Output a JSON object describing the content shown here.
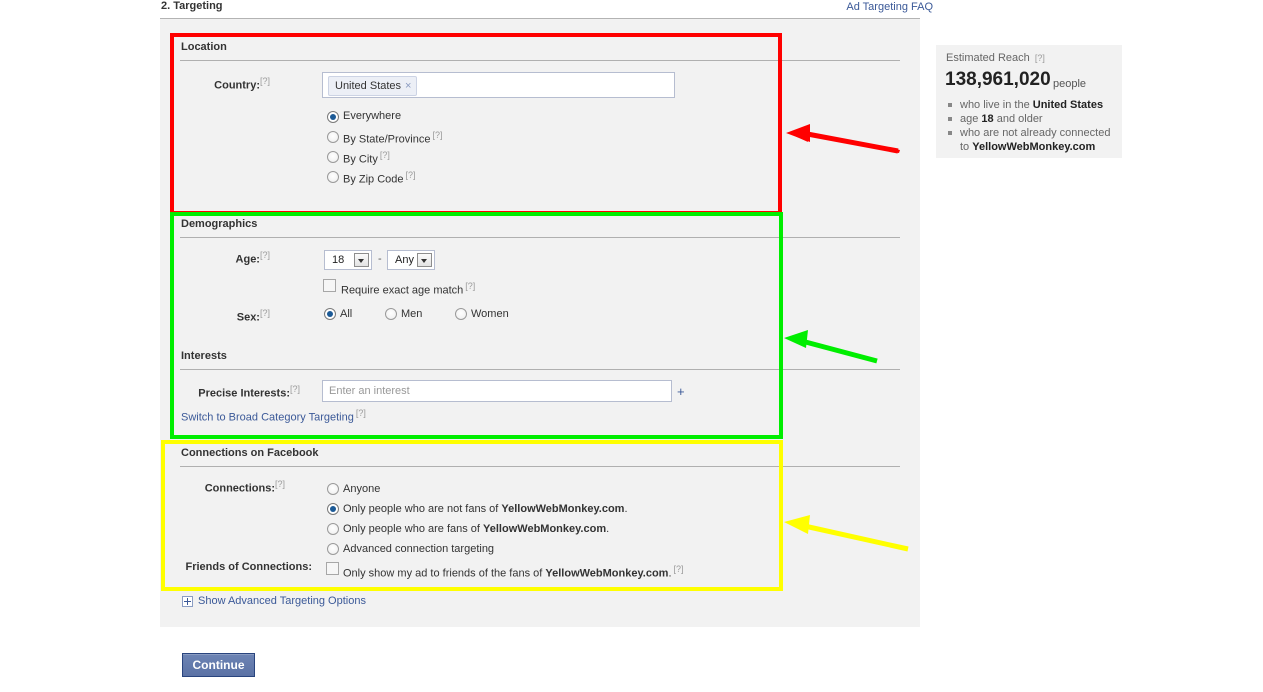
{
  "header": {
    "step_title": "2. Targeting",
    "faq_link": "Ad Targeting FAQ"
  },
  "location": {
    "heading": "Location",
    "country_label": "Country:",
    "help": "[?]",
    "token_value": "United States",
    "token_remove": "×",
    "options": [
      {
        "label": "Everywhere",
        "selected": true,
        "help": ""
      },
      {
        "label": "By State/Province",
        "selected": false,
        "help": "[?]"
      },
      {
        "label": "By City",
        "selected": false,
        "help": "[?]"
      },
      {
        "label": "By Zip Code",
        "selected": false,
        "help": "[?]"
      }
    ]
  },
  "demographics": {
    "heading": "Demographics",
    "age_label": "Age:",
    "age_min": "18",
    "age_max": "Any",
    "age_separator": "-",
    "exact_age_label": "Require exact age match",
    "exact_age_checked": false,
    "sex_label": "Sex:",
    "sex_options": [
      {
        "label": "All",
        "selected": true
      },
      {
        "label": "Men",
        "selected": false
      },
      {
        "label": "Women",
        "selected": false
      }
    ]
  },
  "interests": {
    "heading": "Interests",
    "precise_label": "Precise Interests:",
    "input_placeholder": "Enter an interest",
    "input_value": "",
    "add_icon": "+",
    "switch_link": "Switch to Broad Category Targeting"
  },
  "connections": {
    "heading": "Connections on Facebook",
    "connections_label": "Connections:",
    "options": [
      {
        "text": "Anyone",
        "bold": "",
        "tail": "",
        "selected": false
      },
      {
        "text": "Only people who are not fans of ",
        "bold": "YellowWebMonkey.com",
        "tail": ".",
        "selected": true
      },
      {
        "text": "Only people who are fans of ",
        "bold": "YellowWebMonkey.com",
        "tail": ".",
        "selected": false
      },
      {
        "text": "Advanced connection targeting",
        "bold": "",
        "tail": "",
        "selected": false
      }
    ],
    "friends_label": "Friends of Connections:",
    "friends_text": "Only show my ad to friends of the fans of ",
    "friends_bold": "YellowWebMonkey.com",
    "friends_tail": ".",
    "friends_checked": false
  },
  "advanced": {
    "show_advanced_label": "Show Advanced Targeting Options"
  },
  "footer": {
    "continue_label": "Continue"
  },
  "reach": {
    "title": "Estimated Reach",
    "help": "[?]",
    "number": "138,961,020",
    "unit": "people",
    "bullets": [
      {
        "pre": "who live in the ",
        "bold": "United States",
        "post": ""
      },
      {
        "pre": "age ",
        "bold": "18",
        "post": " and older"
      },
      {
        "pre": "who are not already connected to ",
        "bold": "YellowWebMonkey.com",
        "post": ""
      }
    ]
  },
  "annotations": {
    "colors": {
      "red": "#ff0000",
      "green": "#00ee00",
      "yellow": "#ffff00"
    },
    "boxes": [
      {
        "name": "location-highlight",
        "color": "red"
      },
      {
        "name": "demographics-interests-highlight",
        "color": "green"
      },
      {
        "name": "connections-highlight",
        "color": "yellow"
      }
    ]
  }
}
